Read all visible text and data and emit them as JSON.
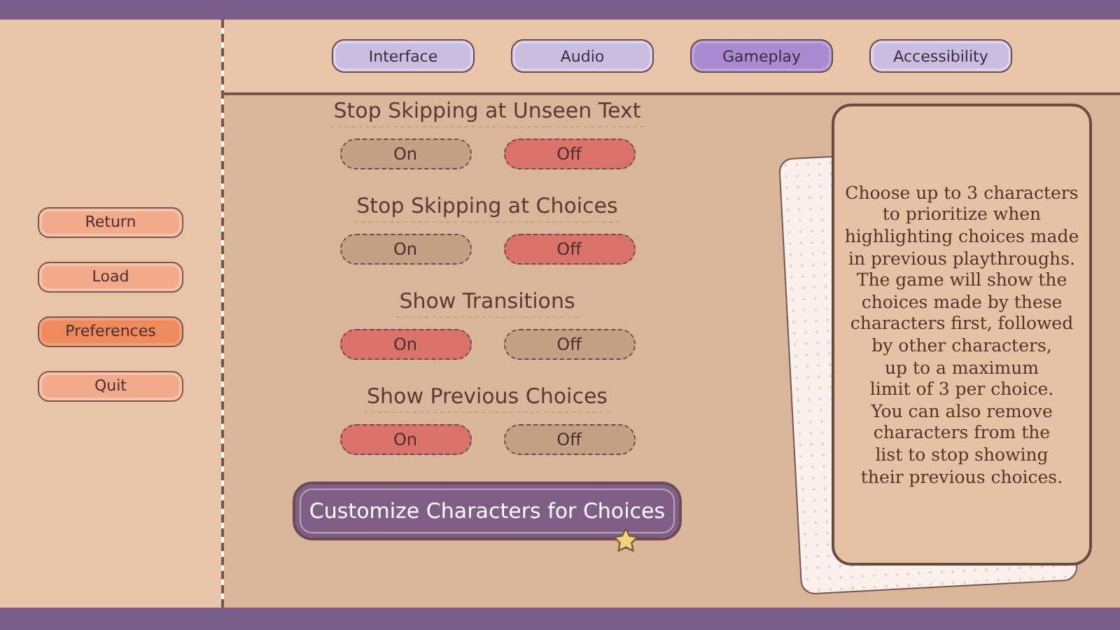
{
  "tabs": [
    {
      "label": "Interface",
      "selected": false
    },
    {
      "label": "Audio",
      "selected": false
    },
    {
      "label": "Gameplay",
      "selected": true
    },
    {
      "label": "Accessibility",
      "selected": false
    }
  ],
  "sidebar": {
    "items": [
      {
        "label": "Return",
        "selected": false
      },
      {
        "label": "Load",
        "selected": false
      },
      {
        "label": "Preferences",
        "selected": true
      },
      {
        "label": "Quit",
        "selected": false
      }
    ]
  },
  "options": [
    {
      "title": "Stop Skipping at Unseen Text",
      "buttons": [
        {
          "label": "On",
          "selected": false
        },
        {
          "label": "Off",
          "selected": true
        }
      ]
    },
    {
      "title": "Stop Skipping at Choices",
      "buttons": [
        {
          "label": "On",
          "selected": false
        },
        {
          "label": "Off",
          "selected": true
        }
      ]
    },
    {
      "title": "Show Transitions",
      "buttons": [
        {
          "label": "On",
          "selected": true
        },
        {
          "label": "Off",
          "selected": false
        }
      ]
    },
    {
      "title": "Show Previous Choices",
      "buttons": [
        {
          "label": "On",
          "selected": true
        },
        {
          "label": "Off",
          "selected": false
        }
      ]
    }
  ],
  "customize_button": {
    "label": "Customize Characters for Choices"
  },
  "info_card": {
    "text": "Choose up to 3 characters\nto prioritize when\nhighlighting choices made\nin previous playthroughs.\nThe game will show the\nchoices made by these\ncharacters first, followed\nby other characters,\nup to a maximum\nlimit of 3 per choice.\nYou can also remove\ncharacters from the\nlist to stop showing\ntheir previous choices."
  }
}
